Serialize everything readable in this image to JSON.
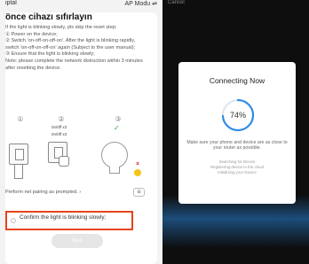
{
  "left": {
    "topbar": {
      "cancel": "iptal",
      "mode": "AP Modu ⇌"
    },
    "title": "önce cihazı sıfırlayın",
    "instructions": [
      "If the light is blinking slowly, pls skip the reset step:",
      "① Power on the device;",
      "② Switch 'on-off-on-off-on'. After the light is blinking rapidly, switch 'on-off-on-off-on' again (Subject to the user manual);",
      "③ Ensure that the light is blinking slowly;",
      "Note: please complete the network distruction within 3 minutes after resetting the device."
    ],
    "illustration": {
      "icon_1": "①",
      "icon_2": "②",
      "icon_3": "③",
      "onoff_1": "0n/0ff x3",
      "onoff_2": "0n/0ff x3",
      "check": "✓",
      "x": "×"
    },
    "prompt": "Perform net pairing as prompted. ›",
    "prompt_button": "⊞",
    "confirm": "Confirm the light is blinking slowly;",
    "next": "Next"
  },
  "right": {
    "cancel": "Cancel",
    "dialog": {
      "title": "Connecting Now",
      "progress_percent": 74,
      "progress_label": "74%",
      "hint": "Make sure your phone and device are as close to your router as possible.",
      "steps": [
        "Searching for Device",
        "Registering device to the cloud",
        "Initializing your Device"
      ]
    }
  },
  "colors": {
    "accent_blue": "#2e8de6",
    "highlight_red": "#e8431c",
    "check_green": "#3aa63a"
  }
}
